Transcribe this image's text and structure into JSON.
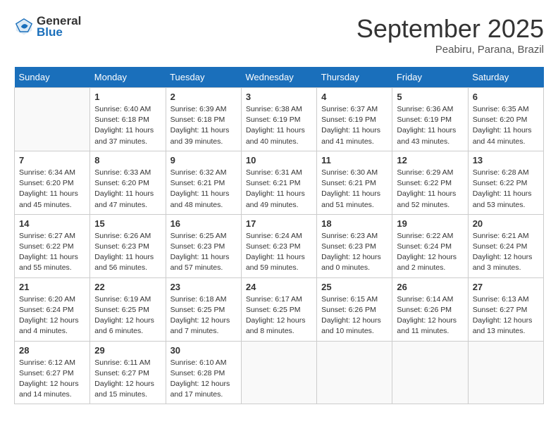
{
  "header": {
    "logo_general": "General",
    "logo_blue": "Blue",
    "month_title": "September 2025",
    "subtitle": "Peabiru, Parana, Brazil"
  },
  "days_of_week": [
    "Sunday",
    "Monday",
    "Tuesday",
    "Wednesday",
    "Thursday",
    "Friday",
    "Saturday"
  ],
  "weeks": [
    [
      {
        "day": "",
        "info": ""
      },
      {
        "day": "1",
        "info": "Sunrise: 6:40 AM\nSunset: 6:18 PM\nDaylight: 11 hours\nand 37 minutes."
      },
      {
        "day": "2",
        "info": "Sunrise: 6:39 AM\nSunset: 6:18 PM\nDaylight: 11 hours\nand 39 minutes."
      },
      {
        "day": "3",
        "info": "Sunrise: 6:38 AM\nSunset: 6:19 PM\nDaylight: 11 hours\nand 40 minutes."
      },
      {
        "day": "4",
        "info": "Sunrise: 6:37 AM\nSunset: 6:19 PM\nDaylight: 11 hours\nand 41 minutes."
      },
      {
        "day": "5",
        "info": "Sunrise: 6:36 AM\nSunset: 6:19 PM\nDaylight: 11 hours\nand 43 minutes."
      },
      {
        "day": "6",
        "info": "Sunrise: 6:35 AM\nSunset: 6:20 PM\nDaylight: 11 hours\nand 44 minutes."
      }
    ],
    [
      {
        "day": "7",
        "info": "Sunrise: 6:34 AM\nSunset: 6:20 PM\nDaylight: 11 hours\nand 45 minutes."
      },
      {
        "day": "8",
        "info": "Sunrise: 6:33 AM\nSunset: 6:20 PM\nDaylight: 11 hours\nand 47 minutes."
      },
      {
        "day": "9",
        "info": "Sunrise: 6:32 AM\nSunset: 6:21 PM\nDaylight: 11 hours\nand 48 minutes."
      },
      {
        "day": "10",
        "info": "Sunrise: 6:31 AM\nSunset: 6:21 PM\nDaylight: 11 hours\nand 49 minutes."
      },
      {
        "day": "11",
        "info": "Sunrise: 6:30 AM\nSunset: 6:21 PM\nDaylight: 11 hours\nand 51 minutes."
      },
      {
        "day": "12",
        "info": "Sunrise: 6:29 AM\nSunset: 6:22 PM\nDaylight: 11 hours\nand 52 minutes."
      },
      {
        "day": "13",
        "info": "Sunrise: 6:28 AM\nSunset: 6:22 PM\nDaylight: 11 hours\nand 53 minutes."
      }
    ],
    [
      {
        "day": "14",
        "info": "Sunrise: 6:27 AM\nSunset: 6:22 PM\nDaylight: 11 hours\nand 55 minutes."
      },
      {
        "day": "15",
        "info": "Sunrise: 6:26 AM\nSunset: 6:23 PM\nDaylight: 11 hours\nand 56 minutes."
      },
      {
        "day": "16",
        "info": "Sunrise: 6:25 AM\nSunset: 6:23 PM\nDaylight: 11 hours\nand 57 minutes."
      },
      {
        "day": "17",
        "info": "Sunrise: 6:24 AM\nSunset: 6:23 PM\nDaylight: 11 hours\nand 59 minutes."
      },
      {
        "day": "18",
        "info": "Sunrise: 6:23 AM\nSunset: 6:23 PM\nDaylight: 12 hours\nand 0 minutes."
      },
      {
        "day": "19",
        "info": "Sunrise: 6:22 AM\nSunset: 6:24 PM\nDaylight: 12 hours\nand 2 minutes."
      },
      {
        "day": "20",
        "info": "Sunrise: 6:21 AM\nSunset: 6:24 PM\nDaylight: 12 hours\nand 3 minutes."
      }
    ],
    [
      {
        "day": "21",
        "info": "Sunrise: 6:20 AM\nSunset: 6:24 PM\nDaylight: 12 hours\nand 4 minutes."
      },
      {
        "day": "22",
        "info": "Sunrise: 6:19 AM\nSunset: 6:25 PM\nDaylight: 12 hours\nand 6 minutes."
      },
      {
        "day": "23",
        "info": "Sunrise: 6:18 AM\nSunset: 6:25 PM\nDaylight: 12 hours\nand 7 minutes."
      },
      {
        "day": "24",
        "info": "Sunrise: 6:17 AM\nSunset: 6:25 PM\nDaylight: 12 hours\nand 8 minutes."
      },
      {
        "day": "25",
        "info": "Sunrise: 6:15 AM\nSunset: 6:26 PM\nDaylight: 12 hours\nand 10 minutes."
      },
      {
        "day": "26",
        "info": "Sunrise: 6:14 AM\nSunset: 6:26 PM\nDaylight: 12 hours\nand 11 minutes."
      },
      {
        "day": "27",
        "info": "Sunrise: 6:13 AM\nSunset: 6:27 PM\nDaylight: 12 hours\nand 13 minutes."
      }
    ],
    [
      {
        "day": "28",
        "info": "Sunrise: 6:12 AM\nSunset: 6:27 PM\nDaylight: 12 hours\nand 14 minutes."
      },
      {
        "day": "29",
        "info": "Sunrise: 6:11 AM\nSunset: 6:27 PM\nDaylight: 12 hours\nand 15 minutes."
      },
      {
        "day": "30",
        "info": "Sunrise: 6:10 AM\nSunset: 6:28 PM\nDaylight: 12 hours\nand 17 minutes."
      },
      {
        "day": "",
        "info": ""
      },
      {
        "day": "",
        "info": ""
      },
      {
        "day": "",
        "info": ""
      },
      {
        "day": "",
        "info": ""
      }
    ]
  ]
}
